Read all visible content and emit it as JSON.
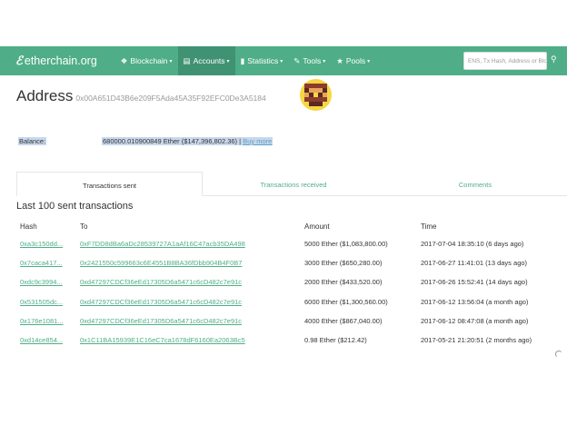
{
  "navbar": {
    "brand": "etherchain.org",
    "items": [
      {
        "icon": "cube-icon",
        "glyph": "❖",
        "label": "Blockchain"
      },
      {
        "icon": "list-icon",
        "glyph": "▤",
        "label": "Accounts"
      },
      {
        "icon": "bar-chart-icon",
        "glyph": "▮",
        "label": "Statistics"
      },
      {
        "icon": "wrench-icon",
        "glyph": "✎",
        "label": "Tools"
      },
      {
        "icon": "star-icon",
        "glyph": "★",
        "label": "Pools"
      }
    ],
    "active_item": "Accounts",
    "search_placeholder": "ENS, Tx Hash, Address or Block"
  },
  "address": {
    "label": "Address",
    "hash": "0x00A651D43B6e209F5Ada45A35F92EFC0De3A5184"
  },
  "balance": {
    "label": "Balance:",
    "value": "680000.010900849 Ether ($147,396,802.36)",
    "separator": "|",
    "buy_label": "Buy more"
  },
  "tabs": [
    {
      "label": "Transactions sent",
      "active": true
    },
    {
      "label": "Transactions received",
      "active": false
    },
    {
      "label": "Comments",
      "active": false
    }
  ],
  "section_title": "Last 100 sent transactions",
  "table": {
    "headers": [
      "Hash",
      "To",
      "Amount",
      "Time"
    ],
    "rows": [
      {
        "hash": "0xa3c150dd...",
        "to": "0xF7DD8dBa6aDc28539727A1aAf16C47acb35DA498",
        "amount": "5000 Ether ($1,083,800.00)",
        "time": "2017-07-04 18:35:10 (6 days ago)"
      },
      {
        "hash": "0x7caca417...",
        "to": "0x2421550c599663c6E4551B8BA36fDbb904B4F0B7",
        "amount": "3000 Ether ($650,280.00)",
        "time": "2017-06-27 11:41:01 (13 days ago)"
      },
      {
        "hash": "0xdc9c3994...",
        "to": "0xd47297CDCf36eEd17305D6a5471c6cD482c7e91c",
        "amount": "2000 Ether ($433,520.00)",
        "time": "2017-06-26 15:52:41 (14 days ago)"
      },
      {
        "hash": "0x531505dc...",
        "to": "0xd47297CDCf36eEd17305D6a5471c6cD482c7e91c",
        "amount": "6000 Ether ($1,300,560.00)",
        "time": "2017-06-12 13:56:04 (a month ago)"
      },
      {
        "hash": "0x176e1081...",
        "to": "0xd47297CDCf36eEd17305D6a5471c6cD482c7e91c",
        "amount": "4000 Ether ($867,040.00)",
        "time": "2017-06-12 08:47:08 (a month ago)"
      },
      {
        "hash": "0xd14ce854...",
        "to": "0x1C11BA15939E1C16eC7ca1678dF6160Ea2063Bc5",
        "amount": "0.98 Ether ($212.42)",
        "time": "2017-05-21 21:20:51 (2 months ago)"
      }
    ]
  },
  "colors": {
    "brand_green": "#4fae87",
    "active_nav": "#3f9272",
    "link": "#4fae87",
    "highlight": "#c8d8ec"
  }
}
